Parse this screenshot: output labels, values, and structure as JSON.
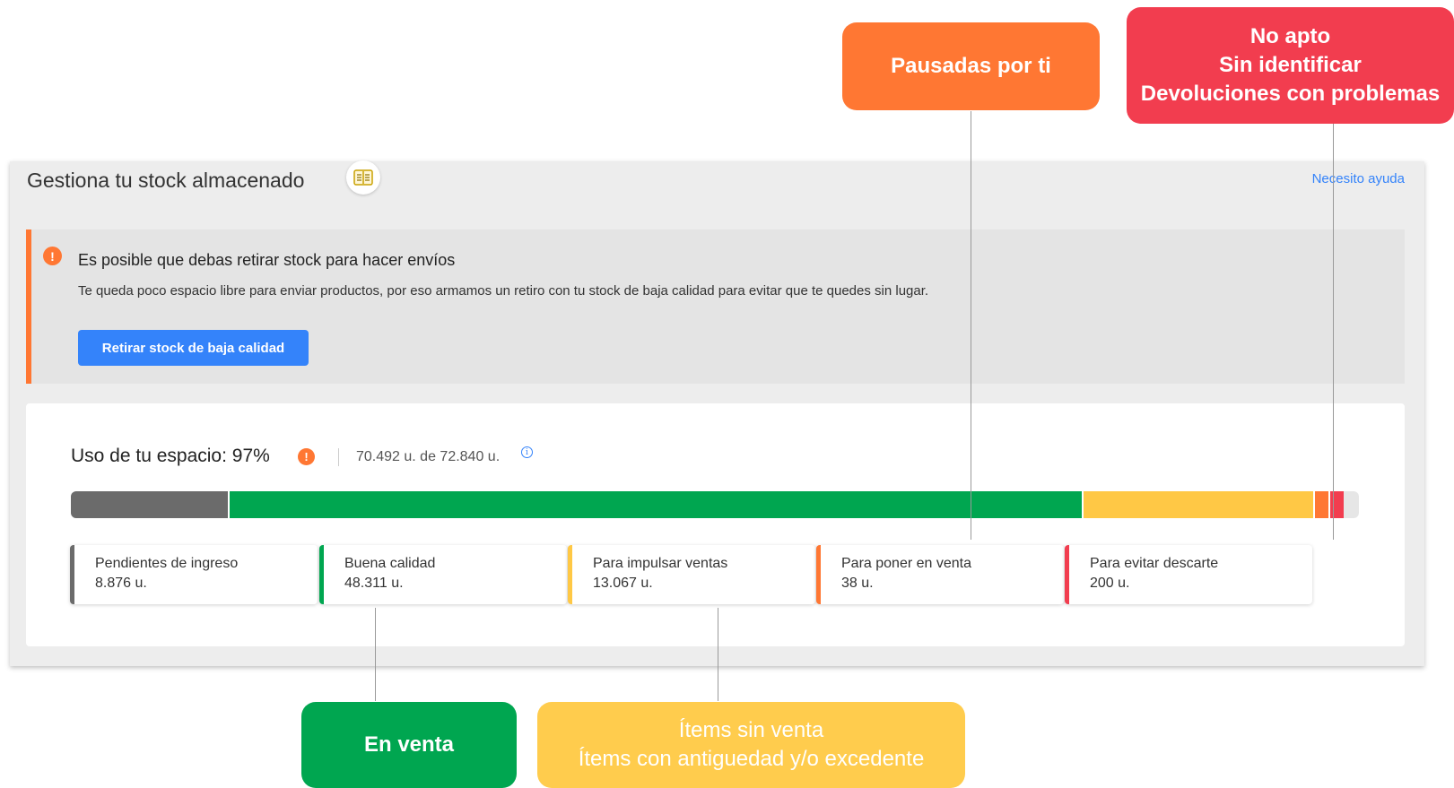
{
  "panel": {
    "title": "Gestiona tu stock almacenado",
    "guide_icon": "book-icon",
    "help_link": "Necesito ayuda"
  },
  "alert": {
    "icon": "exclamation-icon",
    "icon_glyph": "!",
    "title": "Es posible que debas retirar stock para hacer envíos",
    "body": "Te queda poco espacio libre para enviar productos, por eso armamos un retiro con tu stock de baja calidad para evitar que te quedes sin lugar.",
    "button": "Retirar stock de baja calidad",
    "accent_color": "#ff7733"
  },
  "usage": {
    "title": "Uso de tu espacio: 97%",
    "percent": 97,
    "warn_glyph": "!",
    "detail": "70.492 u. de 72.840 u.",
    "info_glyph": "i",
    "total_units": 72840,
    "used_units": 70492,
    "segments": [
      {
        "name": "pendientes",
        "units": 8876,
        "color": "#6b6b6b"
      },
      {
        "name": "buena",
        "units": 48311,
        "color": "#00a650"
      },
      {
        "name": "impulsar",
        "units": 13067,
        "color": "#ffc845"
      },
      {
        "name": "poner",
        "units": 38,
        "color": "#ff7733"
      },
      {
        "name": "descarte",
        "units": 200,
        "color": "#f23d4f"
      }
    ],
    "categories": [
      {
        "label": "Pendientes de ingreso",
        "value": "8.876 u.",
        "color": "#6b6b6b"
      },
      {
        "label": "Buena calidad",
        "value": "48.311 u.",
        "color": "#00a650"
      },
      {
        "label": "Para impulsar ventas",
        "value": "13.067 u.",
        "color": "#ffc845"
      },
      {
        "label": "Para poner en venta",
        "value": "38 u.",
        "color": "#ff7733"
      },
      {
        "label": "Para evitar descarte",
        "value": "200 u.",
        "color": "#f23d4f"
      }
    ]
  },
  "callouts": {
    "paused": {
      "lines": [
        "Pausadas por ti"
      ],
      "color": "#ff7733"
    },
    "not_fit": {
      "lines": [
        "No apto",
        "Sin identificar",
        "Devoluciones con problemas"
      ],
      "color": "#f23d4f"
    },
    "on_sale": {
      "lines": [
        "En venta"
      ],
      "color": "#00a650"
    },
    "no_sale": {
      "lines": [
        "Ítems sin venta",
        "Ítems con antiguedad y/o excedente"
      ],
      "color": "#ffcc4d"
    }
  }
}
